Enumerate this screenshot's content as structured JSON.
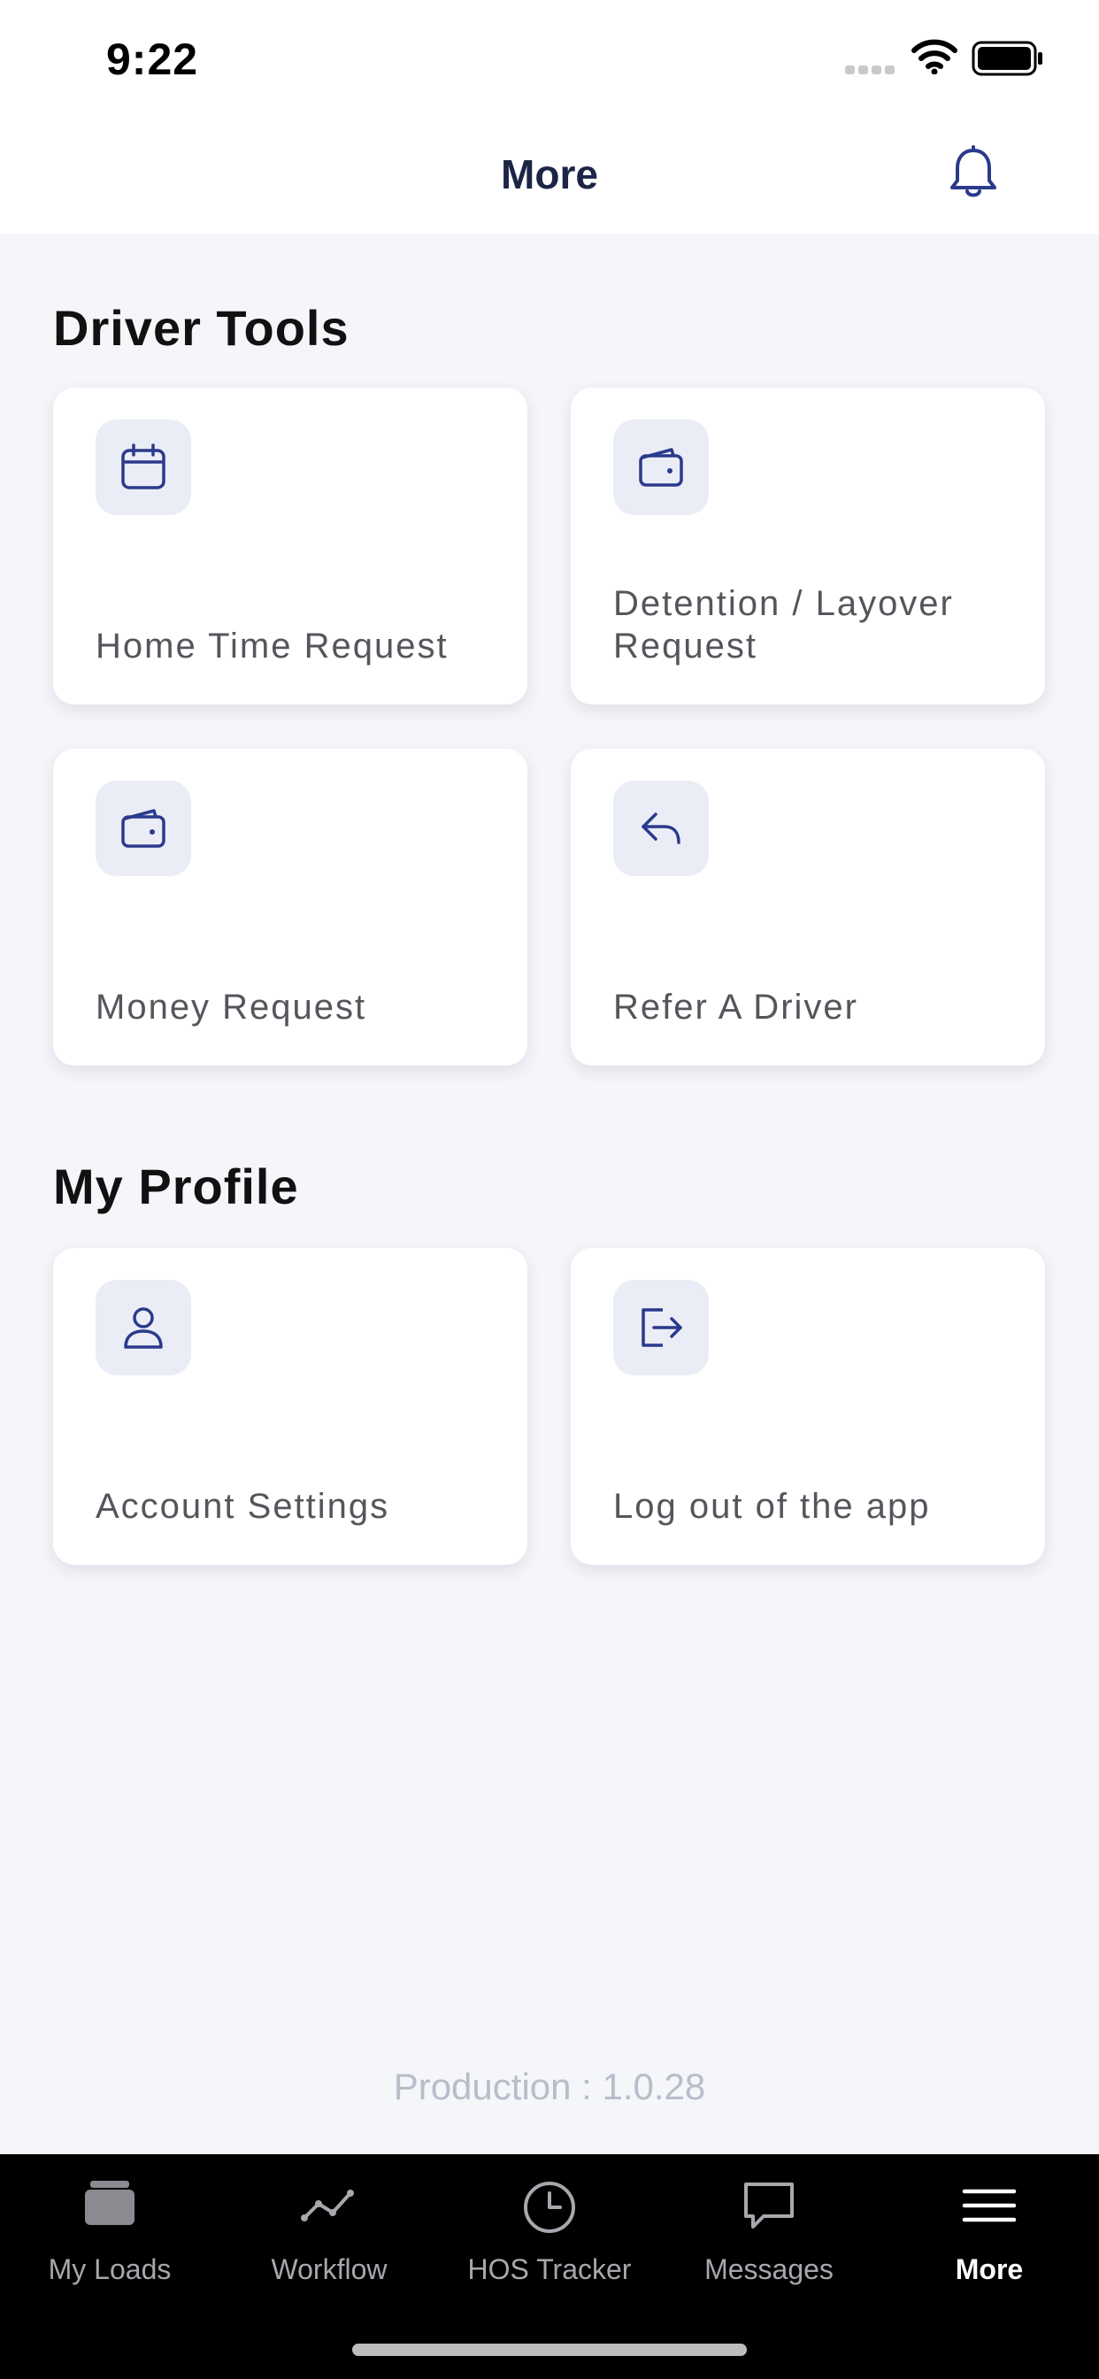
{
  "status_bar": {
    "time": "9:22"
  },
  "header": {
    "title": "More"
  },
  "sections": [
    {
      "title": "Driver Tools",
      "cards": [
        {
          "label": "Home Time Request",
          "icon": "calendar-icon"
        },
        {
          "label": "Detention / Layover Request",
          "icon": "wallet-icon"
        },
        {
          "label": "Money Request",
          "icon": "wallet-icon"
        },
        {
          "label": "Refer A Driver",
          "icon": "reply-arrow-icon"
        }
      ]
    },
    {
      "title": "My Profile",
      "cards": [
        {
          "label": "Account Settings",
          "icon": "user-icon"
        },
        {
          "label": "Log out of the app",
          "icon": "logout-icon"
        }
      ]
    }
  ],
  "footer": {
    "version": "Production : 1.0.28"
  },
  "tabbar": {
    "items": [
      {
        "label": "My Loads",
        "icon": "stack-icon",
        "active": false
      },
      {
        "label": "Workflow",
        "icon": "line-graph-icon",
        "active": false
      },
      {
        "label": "HOS Tracker",
        "icon": "clock-icon",
        "active": false
      },
      {
        "label": "Messages",
        "icon": "chat-bubble-icon",
        "active": false
      },
      {
        "label": "More",
        "icon": "menu-icon",
        "active": true
      }
    ]
  },
  "colors": {
    "accent": "#2b3a8c",
    "background": "#f5f6fa",
    "icon_tile": "#eaedf5",
    "tab_inactive": "#a7a7ad",
    "tab_active": "#ffffff"
  }
}
